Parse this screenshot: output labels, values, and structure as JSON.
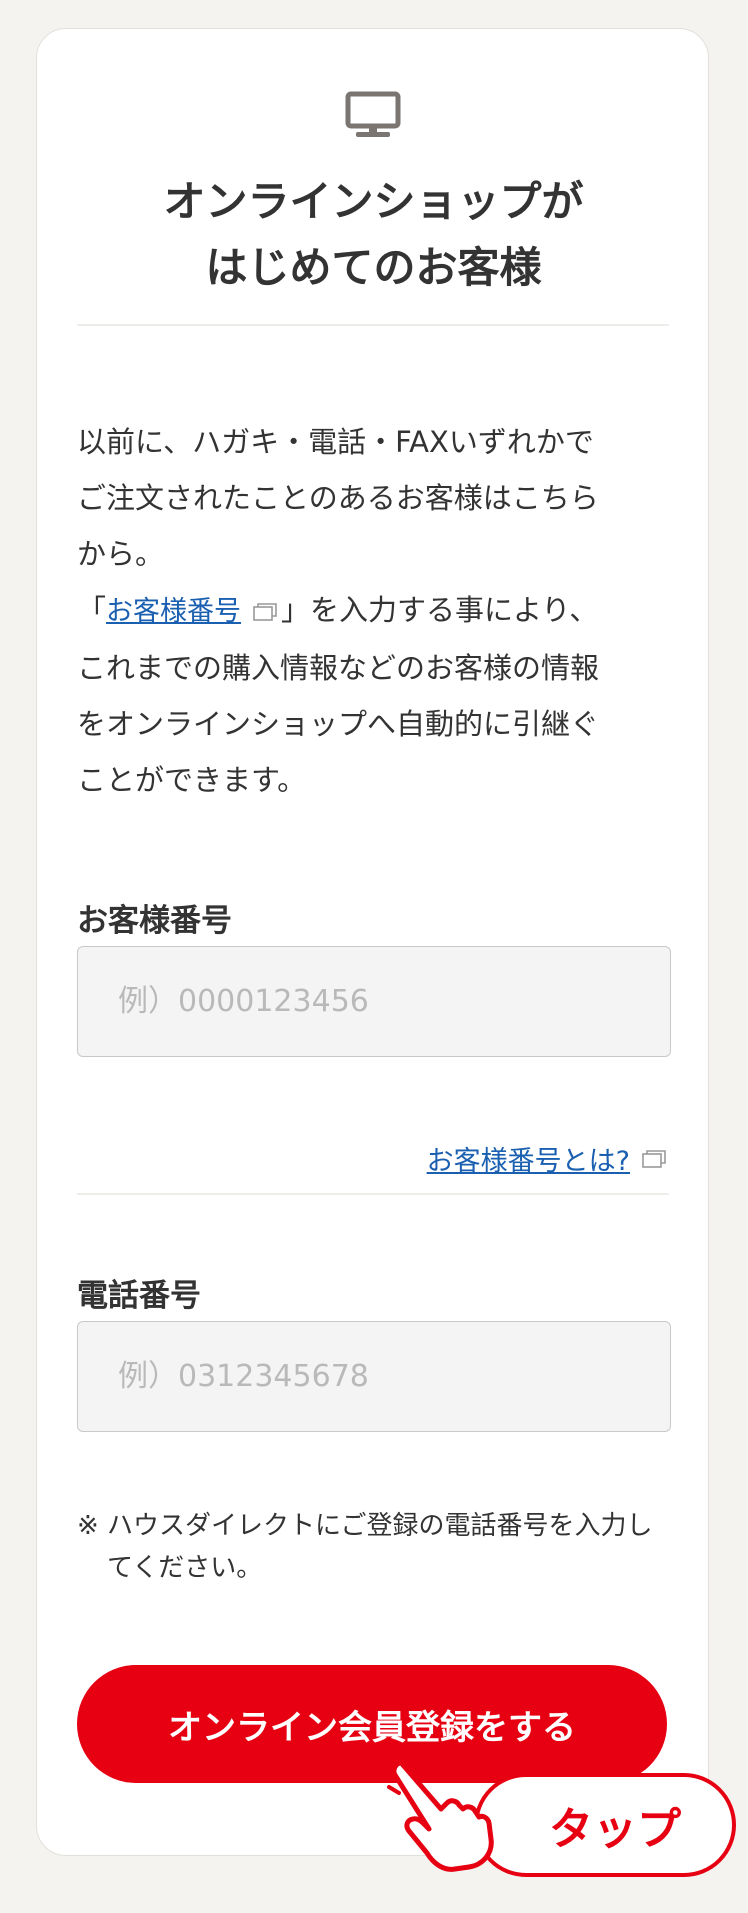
{
  "card": {
    "title_line1": "オンラインショップが",
    "title_line2": "はじめてのお客様",
    "description": {
      "line1": "以前に、ハガキ・電話・FAXいずれかで",
      "line2": "ご注文されたことのあるお客様はこちら",
      "line3": "から。",
      "line4_prefix": "「",
      "line4_link": "お客様番号",
      "line4_suffix": "」を入力する事により、",
      "line5": "これまでの購入情報などのお客様の情報",
      "line6": "をオンラインショップへ自動的に引継ぐ",
      "line7": "ことができます。"
    },
    "customer_number": {
      "label": "お客様番号",
      "placeholder": "例）0000123456",
      "value": "",
      "help_link": "お客様番号とは?"
    },
    "phone_number": {
      "label": "電話番号",
      "placeholder": "例）0312345678",
      "value": ""
    },
    "note": "※ ハウスダイレクトにご登録の電話番号を入力してください。",
    "register_button": "オンライン会員登録をする",
    "tap_badge": "タップ"
  },
  "icons": {
    "monitor": "monitor-icon",
    "external_window": "external-window-icon",
    "pointing_hand": "pointing-hand-icon"
  },
  "colors": {
    "background": "#f4f3ef",
    "accent": "#e60012",
    "link": "#1a5fb0",
    "text": "#333333",
    "icon_gray": "#7a7570"
  }
}
